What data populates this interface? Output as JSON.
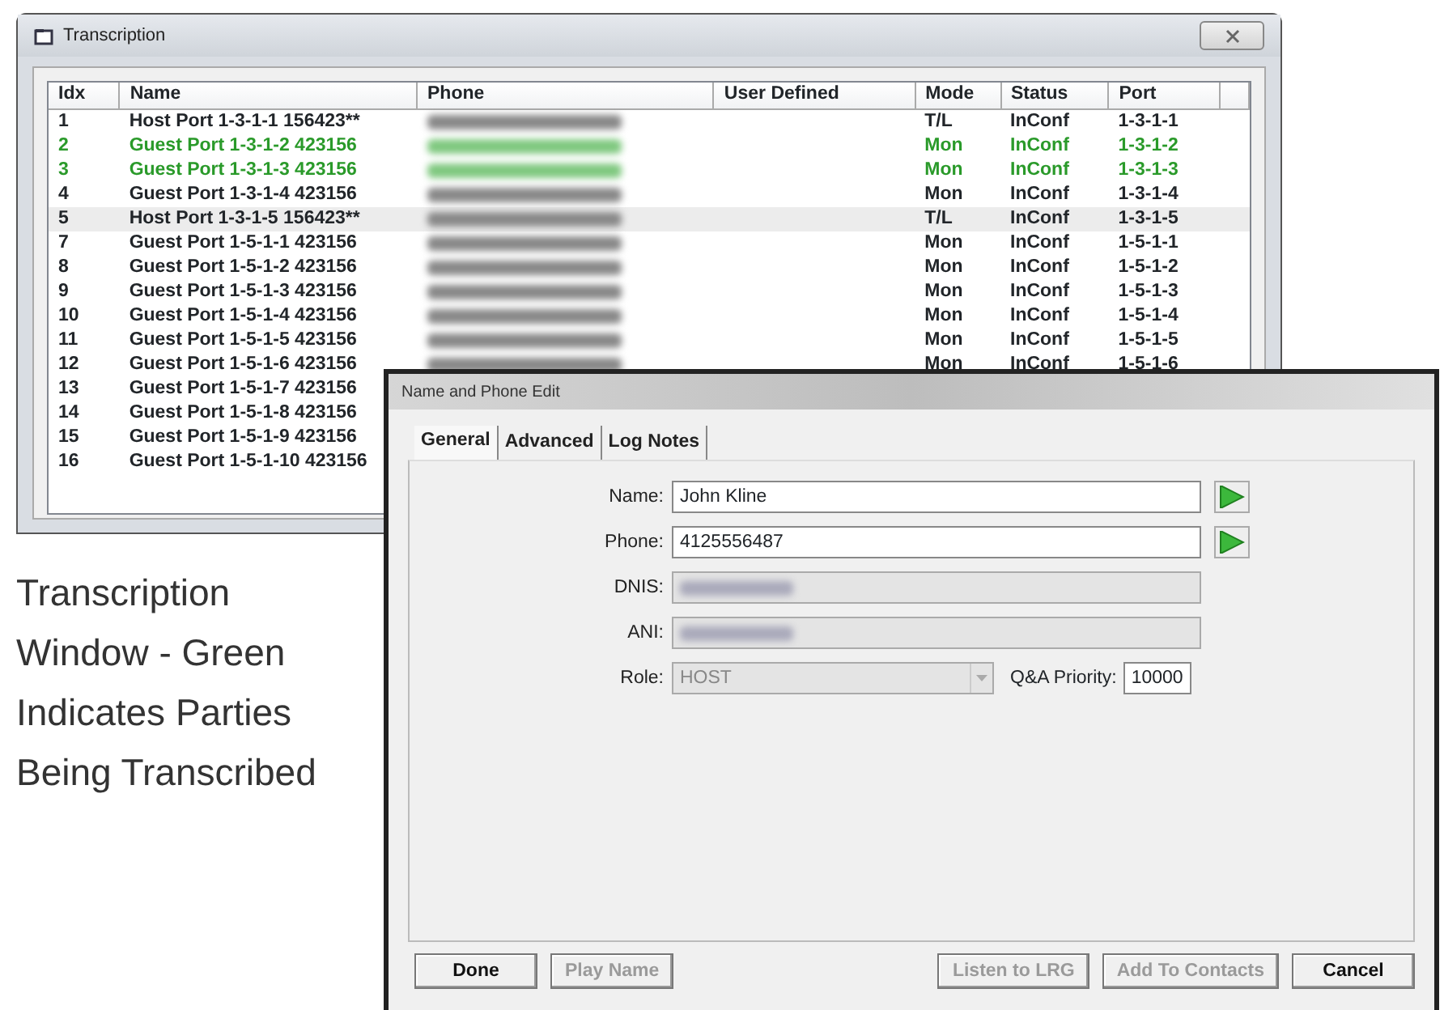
{
  "transcription_window": {
    "title": "Transcription",
    "columns": [
      "Idx",
      "Name",
      "Phone",
      "User Defined",
      "Mode",
      "Status",
      "Port"
    ],
    "rows": [
      {
        "idx": "1",
        "name": "Host Port 1-3-1-1 156423**",
        "phone_blurred": true,
        "mode": "T/L",
        "status": "InConf",
        "port": "1-3-1-1",
        "transcribed": false,
        "selected": false
      },
      {
        "idx": "2",
        "name": "Guest Port 1-3-1-2 423156",
        "phone_blurred": true,
        "mode": "Mon",
        "status": "InConf",
        "port": "1-3-1-2",
        "transcribed": true,
        "selected": false
      },
      {
        "idx": "3",
        "name": "Guest Port 1-3-1-3 423156",
        "phone_blurred": true,
        "mode": "Mon",
        "status": "InConf",
        "port": "1-3-1-3",
        "transcribed": true,
        "selected": false
      },
      {
        "idx": "4",
        "name": "Guest Port 1-3-1-4 423156",
        "phone_blurred": true,
        "mode": "Mon",
        "status": "InConf",
        "port": "1-3-1-4",
        "transcribed": false,
        "selected": false
      },
      {
        "idx": "5",
        "name": "Host Port 1-3-1-5 156423**",
        "phone_blurred": true,
        "mode": "T/L",
        "status": "InConf",
        "port": "1-3-1-5",
        "transcribed": false,
        "selected": true
      },
      {
        "idx": "7",
        "name": "Guest Port 1-5-1-1 423156",
        "phone_blurred": true,
        "mode": "Mon",
        "status": "InConf",
        "port": "1-5-1-1",
        "transcribed": false,
        "selected": false
      },
      {
        "idx": "8",
        "name": "Guest Port 1-5-1-2 423156",
        "phone_blurred": true,
        "mode": "Mon",
        "status": "InConf",
        "port": "1-5-1-2",
        "transcribed": false,
        "selected": false
      },
      {
        "idx": "9",
        "name": "Guest Port 1-5-1-3 423156",
        "phone_blurred": true,
        "mode": "Mon",
        "status": "InConf",
        "port": "1-5-1-3",
        "transcribed": false,
        "selected": false
      },
      {
        "idx": "10",
        "name": "Guest Port 1-5-1-4 423156",
        "phone_blurred": true,
        "mode": "Mon",
        "status": "InConf",
        "port": "1-5-1-4",
        "transcribed": false,
        "selected": false
      },
      {
        "idx": "11",
        "name": "Guest Port 1-5-1-5 423156",
        "phone_blurred": true,
        "mode": "Mon",
        "status": "InConf",
        "port": "1-5-1-5",
        "transcribed": false,
        "selected": false
      },
      {
        "idx": "12",
        "name": "Guest Port 1-5-1-6 423156",
        "phone_blurred": true,
        "mode": "Mon",
        "status": "InConf",
        "port": "1-5-1-6",
        "transcribed": false,
        "selected": false
      },
      {
        "idx": "13",
        "name": "Guest Port 1-5-1-7 423156",
        "transcribed": false,
        "selected": false
      },
      {
        "idx": "14",
        "name": "Guest Port 1-5-1-8 423156",
        "transcribed": false,
        "selected": false
      },
      {
        "idx": "15",
        "name": "Guest Port 1-5-1-9 423156",
        "transcribed": false,
        "selected": false
      },
      {
        "idx": "16",
        "name": "Guest Port 1-5-1-10 423156",
        "transcribed": false,
        "selected": false
      }
    ]
  },
  "caption_lines": [
    "Transcription",
    "Window - Green",
    "Indicates Parties",
    "Being Transcribed"
  ],
  "dialog": {
    "title": "Name and Phone Edit",
    "tabs": [
      {
        "label": "General",
        "selected": true
      },
      {
        "label": "Advanced",
        "selected": false
      },
      {
        "label": "Log Notes",
        "selected": false
      }
    ],
    "fields": [
      {
        "kind": "text",
        "label": "Name:",
        "value": "John Kline",
        "disabled": false,
        "play_button": true
      },
      {
        "kind": "text",
        "label": "Phone:",
        "value": "4125556487",
        "disabled": false,
        "play_button": true
      },
      {
        "kind": "blurred",
        "label": "DNIS:",
        "disabled": true
      },
      {
        "kind": "blurred",
        "label": "ANI:",
        "disabled": true
      },
      {
        "kind": "select",
        "label": "Role:",
        "value": "HOST",
        "disabled": true,
        "extra_label": "Q&A Priority:",
        "extra_value": "10000"
      }
    ],
    "left_buttons": [
      {
        "label": "Done",
        "disabled": false
      },
      {
        "label": "Play Name",
        "disabled": true
      }
    ],
    "right_buttons": [
      {
        "label": "Listen to LRG",
        "disabled": true
      },
      {
        "label": "Add To Contacts",
        "disabled": true
      },
      {
        "label": "Cancel",
        "disabled": false
      }
    ]
  }
}
